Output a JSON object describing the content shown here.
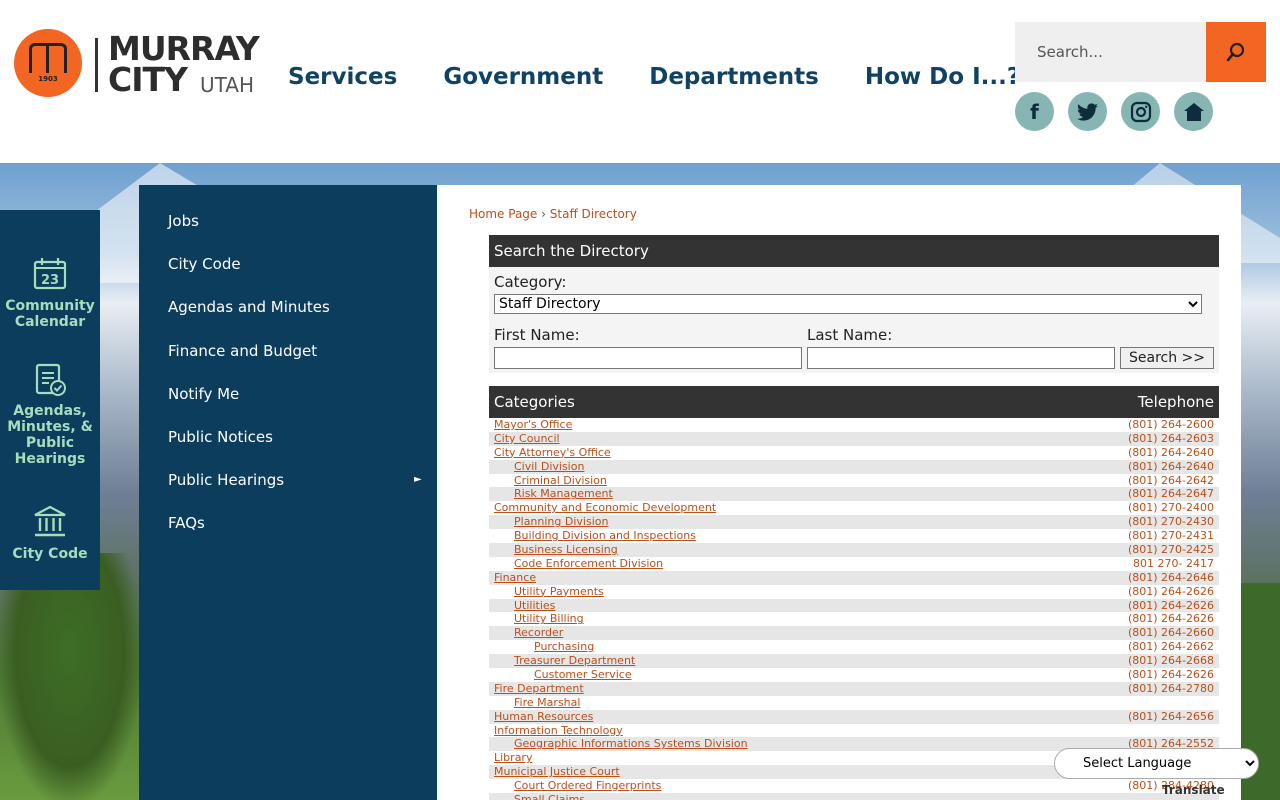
{
  "header": {
    "logo_year": "1903",
    "logo_line1": "MURRAY",
    "logo_line2": "CITY",
    "logo_line3": "UTAH",
    "nav": [
      "Services",
      "Government",
      "Departments",
      "How Do I...?"
    ],
    "search_placeholder": "Search...",
    "social": [
      {
        "icon": "facebook-icon",
        "glyph": "f"
      },
      {
        "icon": "twitter-icon",
        "glyph": "t"
      },
      {
        "icon": "instagram-icon",
        "glyph": "◎"
      },
      {
        "icon": "nextdoor-icon",
        "glyph": "⌂"
      }
    ]
  },
  "quick_links": [
    {
      "label": "Community Calendar",
      "icon": "calendar-icon",
      "day": "23"
    },
    {
      "label": "Agendas, Minutes, & Public Hearings",
      "icon": "clipboard-check-icon"
    },
    {
      "label": "City Code",
      "icon": "building-columns-icon"
    }
  ],
  "side_menu": [
    "Jobs",
    "City Code",
    "Agendas and Minutes",
    "Finance and Budget",
    "Notify Me",
    "Public Notices",
    "Public Hearings",
    "FAQs"
  ],
  "breadcrumb": {
    "home": "Home Page",
    "separator": "›",
    "current": "Staff Directory"
  },
  "directory_search": {
    "title": "Search the Directory",
    "category_label": "Category:",
    "category_value": "Staff Directory",
    "first_name_label": "First Name:",
    "last_name_label": "Last Name:",
    "button": "Search >>"
  },
  "categories": {
    "header_left": "Categories",
    "header_right": "Telephone",
    "rows": [
      {
        "name": "Mayor's Office",
        "tel": "(801) 264-2600",
        "level": 0
      },
      {
        "name": "City Council",
        "tel": "(801) 264-2603",
        "level": 0
      },
      {
        "name": "City Attorney's Office",
        "tel": "(801) 264-2640",
        "level": 0
      },
      {
        "name": "Civil Division",
        "tel": "(801) 264-2640",
        "level": 1
      },
      {
        "name": "Criminal Division",
        "tel": "(801) 264-2642",
        "level": 1
      },
      {
        "name": "Risk Management",
        "tel": "(801) 264-2647",
        "level": 1
      },
      {
        "name": "Community and Economic Development",
        "tel": "(801) 270-2400",
        "level": 0
      },
      {
        "name": "Planning Division",
        "tel": "(801) 270-2430",
        "level": 1
      },
      {
        "name": "Building Division and Inspections",
        "tel": "(801) 270-2431",
        "level": 1
      },
      {
        "name": "Business Licensing",
        "tel": "(801) 270-2425",
        "level": 1
      },
      {
        "name": "Code Enforcement Division",
        "tel": "801 270- 2417",
        "level": 1
      },
      {
        "name": "Finance",
        "tel": "(801) 264-2646",
        "level": 0
      },
      {
        "name": "Utility Payments",
        "tel": "(801) 264-2626",
        "level": 1
      },
      {
        "name": "Utilities",
        "tel": "(801) 264-2626",
        "level": 1
      },
      {
        "name": "Utility Billing",
        "tel": "(801) 264-2626",
        "level": 1
      },
      {
        "name": "Recorder",
        "tel": "(801) 264-2660",
        "level": 1
      },
      {
        "name": "Purchasing",
        "tel": "(801) 264-2662",
        "level": 2
      },
      {
        "name": "Treasurer Department",
        "tel": "(801) 264-2668",
        "level": 1
      },
      {
        "name": "Customer Service",
        "tel": "(801) 264-2626",
        "level": 2
      },
      {
        "name": "Fire Department",
        "tel": "(801) 264-2780",
        "level": 0
      },
      {
        "name": "Fire Marshal",
        "tel": "",
        "level": 1
      },
      {
        "name": "Human Resources",
        "tel": "(801) 264-2656",
        "level": 0
      },
      {
        "name": "Information Technology",
        "tel": "",
        "level": 0
      },
      {
        "name": "Geographic Informations Systems Division",
        "tel": "(801) 264-2552",
        "level": 1
      },
      {
        "name": "Library",
        "tel": "",
        "level": 0
      },
      {
        "name": "Municipal Justice Court",
        "tel": "",
        "level": 0
      },
      {
        "name": "Court Ordered Fingerprints",
        "tel": "(801) 284-4280",
        "level": 1
      },
      {
        "name": "Small Claims",
        "tel": "",
        "level": 1
      }
    ]
  },
  "translate": {
    "select_label": "Select Language",
    "powered": "Translate"
  }
}
